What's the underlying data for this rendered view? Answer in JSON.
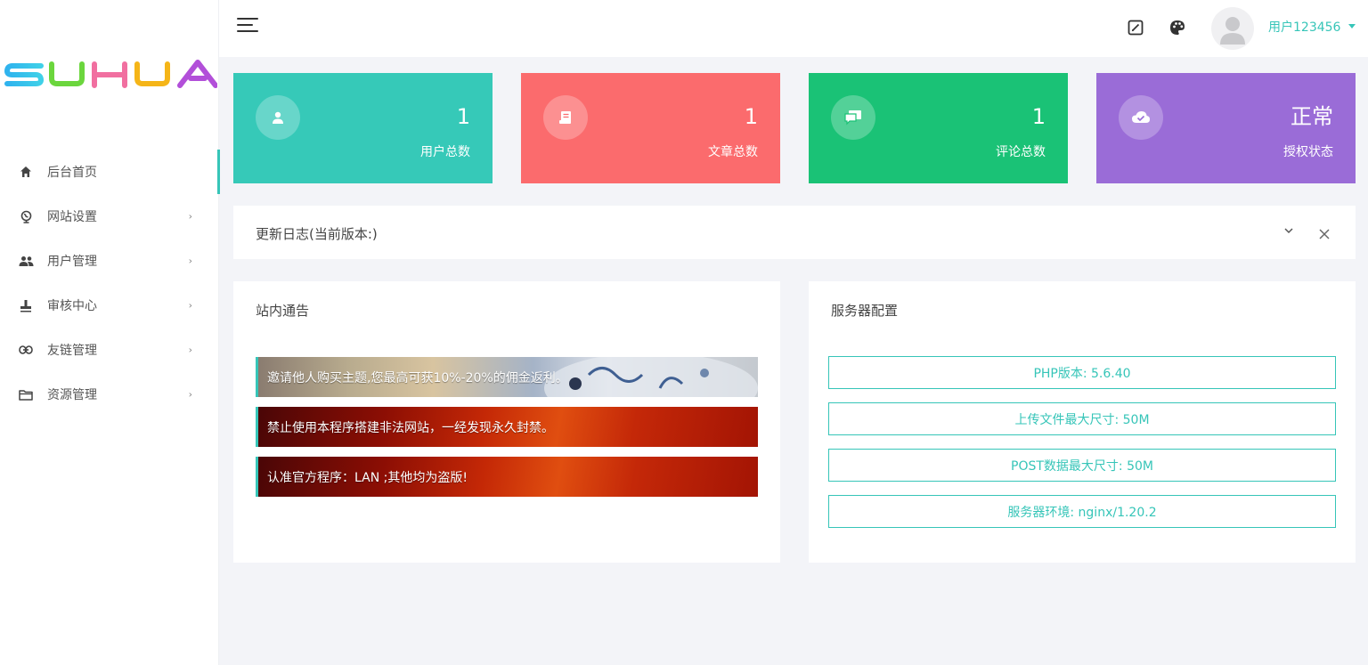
{
  "logo": {
    "text": "SUHUA"
  },
  "sidebar": {
    "items": [
      {
        "label": "后台首页",
        "icon": "home-icon",
        "active": true
      },
      {
        "label": "网站设置",
        "icon": "globe-icon"
      },
      {
        "label": "用户管理",
        "icon": "users-icon"
      },
      {
        "label": "审核中心",
        "icon": "stamp-icon"
      },
      {
        "label": "友链管理",
        "icon": "link-icon"
      },
      {
        "label": "资源管理",
        "icon": "folder-icon"
      }
    ]
  },
  "header": {
    "username": "用户123456",
    "icons": [
      "menu-icon",
      "edit-icon",
      "palette-icon",
      "avatar-icon"
    ]
  },
  "stats": [
    {
      "value": "1",
      "label": "用户总数",
      "color": "#36c9b8",
      "icon": "user-icon"
    },
    {
      "value": "1",
      "label": "文章总数",
      "color": "#fb6b6d",
      "icon": "article-icon"
    },
    {
      "value": "1",
      "label": "评论总数",
      "color": "#1ac276",
      "icon": "comment-icon"
    },
    {
      "value": "正常",
      "label": "授权状态",
      "color": "#9a6cd7",
      "icon": "cloud-check-icon"
    }
  ],
  "update_log": {
    "title": "更新日志(当前版本:)"
  },
  "notice_panel": {
    "title": "站内通告",
    "items": [
      "邀请他人购买主题,您最高可获10%-20%的佣金返利。",
      "禁止使用本程序搭建非法网站，一经发现永久封禁。",
      "认准官方程序：LAN ;其他均为盗版!"
    ]
  },
  "server_panel": {
    "title": "服务器配置",
    "items": [
      "PHP版本: 5.6.40",
      "上传文件最大尺寸: 50M",
      "POST数据最大尺寸: 50M",
      "服务器环境: nginx/1.20.2"
    ]
  },
  "colors": {
    "accent": "#36c5b8"
  }
}
